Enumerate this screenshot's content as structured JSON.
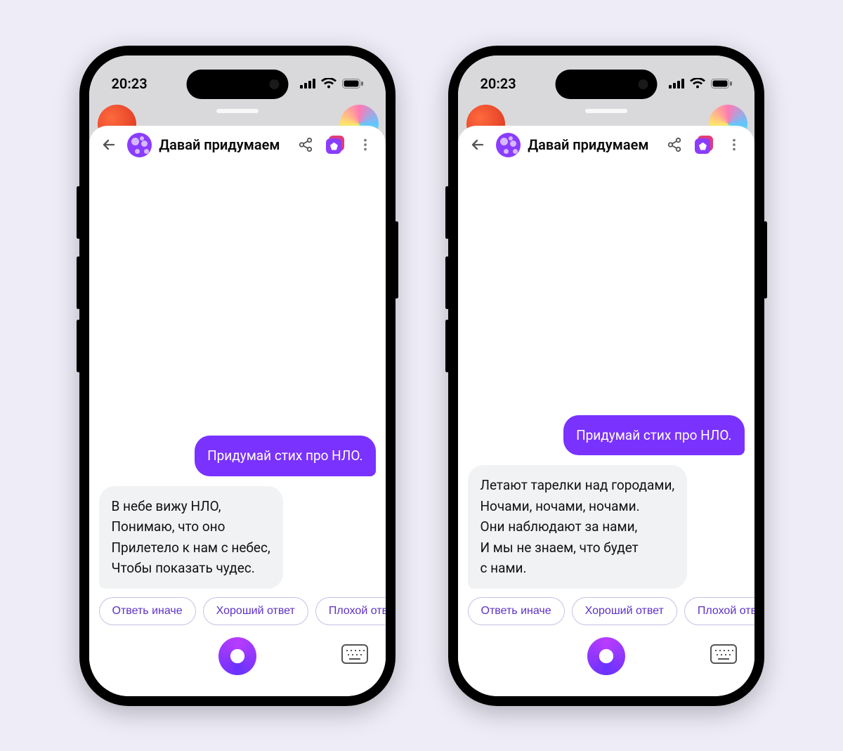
{
  "status_time": "20:23",
  "header_title": "Давай придумаем",
  "phones": [
    {
      "user_message": "Придумай стих про НЛО.",
      "assistant_message": "В небе вижу НЛО,\nПонимаю, что оно\nПрилетело к нам с небес,\nЧтобы показать чудес."
    },
    {
      "user_message": "Придумай стих про НЛО.",
      "assistant_message": "Летают тарелки над городами,\nНочами, ночами, ночами.\nОни наблюдают за нами,\nИ мы не знаем, что будет\nс нами."
    }
  ],
  "feedback_chips": {
    "alt": "Ответь иначе",
    "good": "Хороший ответ",
    "bad": "Плохой ответ"
  }
}
